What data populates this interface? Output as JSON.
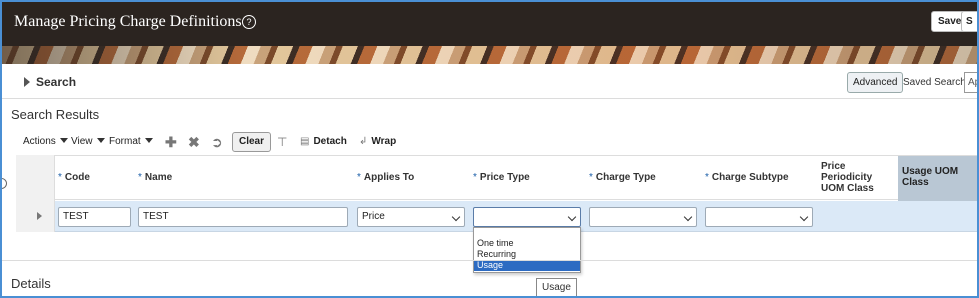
{
  "header": {
    "title": "Manage Pricing Charge Definitions",
    "help_glyph": "?",
    "save_label": "Save",
    "next_label": "S"
  },
  "search": {
    "label": "Search",
    "advanced_label": "Advanced",
    "saved_search_label": "Saved Search",
    "saved_search_value": "Ap"
  },
  "results": {
    "title": "Search Results",
    "toolbar": {
      "actions": "Actions",
      "view": "View",
      "format": "Format",
      "clear": "Clear",
      "detach": "Detach",
      "wrap": "Wrap"
    },
    "columns": {
      "code": "Code",
      "name": "Name",
      "applies_to": "Applies To",
      "price_type": "Price Type",
      "charge_type": "Charge Type",
      "charge_subtype": "Charge Subtype",
      "price_periodicity_uom_class": [
        "Price",
        "Periodicity",
        "UOM Class"
      ],
      "usage_uom_class": [
        "Usage UOM",
        "Class"
      ]
    },
    "required_marker": "*",
    "row": {
      "code": "TEST",
      "name": "TEST",
      "applies_to": "Price",
      "price_type": "",
      "charge_type": "",
      "charge_subtype": ""
    },
    "price_type_options": [
      "One time",
      "Recurring",
      "Usage"
    ],
    "price_type_highlighted": "Usage"
  },
  "details": {
    "title": "Details",
    "tooltip": "Usage"
  },
  "colors": {
    "header_bg": "#2b2420",
    "frame_border": "#4a8fd4",
    "row_highlight": "#dbe9f7",
    "selected_option": "#2d6bc2",
    "usage_col_header": "#b9c7d4"
  }
}
